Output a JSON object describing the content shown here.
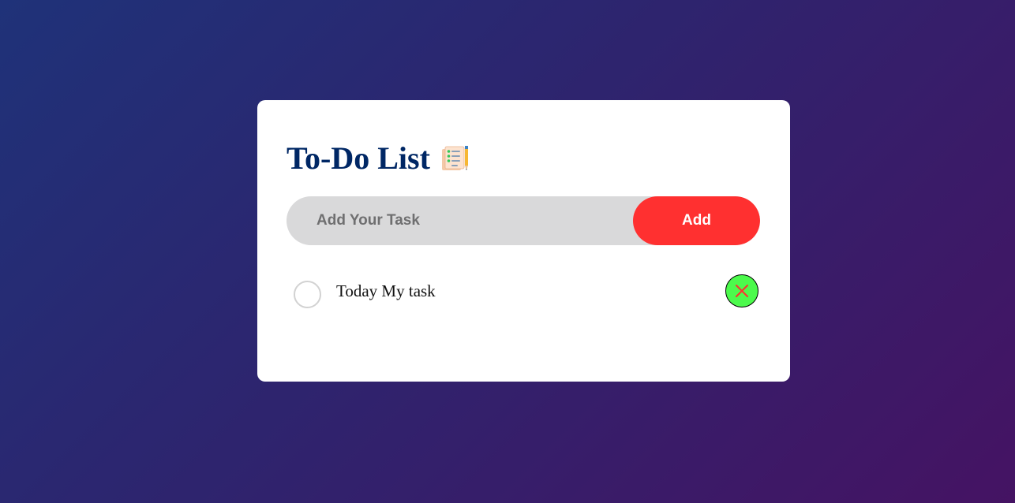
{
  "app": {
    "title": "To-Do List"
  },
  "input": {
    "placeholder": "Add Your Task",
    "value": "",
    "add_label": "Add"
  },
  "tasks": [
    {
      "text": "Today My task",
      "checked": false,
      "delete_icon": "close-icon"
    }
  ],
  "icons": {
    "title_icon": "notepad-checklist-icon",
    "check": "circle-unchecked-icon",
    "delete": "close-icon"
  },
  "colors": {
    "title": "#002765",
    "add_button": "#ff3030",
    "input_bg": "#d9d9da",
    "delete_bg": "#4cfa4c",
    "delete_x": "#ff3030",
    "card_bg": "#ffffff"
  }
}
